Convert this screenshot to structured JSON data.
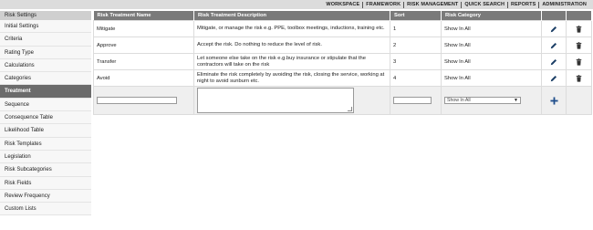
{
  "topnav": {
    "items": [
      "WORKSPACE",
      "FRAMEWORK",
      "RISK MANAGEMENT",
      "QUICK SEARCH",
      "REPORTS",
      "ADMINISTRATION"
    ]
  },
  "sidebar": {
    "header": "Risk Settings",
    "items": [
      {
        "label": "Initial Settings"
      },
      {
        "label": "Criteria"
      },
      {
        "label": "Rating Type"
      },
      {
        "label": "Calculations"
      },
      {
        "label": "Categories"
      },
      {
        "label": "Treatment",
        "active": true
      },
      {
        "label": "Sequence"
      },
      {
        "label": "Consequence Table"
      },
      {
        "label": "Likelihood Table"
      },
      {
        "label": "Risk Templates"
      },
      {
        "label": "Legislation"
      },
      {
        "label": "Risk Subcategories"
      },
      {
        "label": "Risk Fields"
      },
      {
        "label": "Review Frequency"
      },
      {
        "label": "Custom Lists"
      }
    ]
  },
  "table": {
    "columns": [
      "Risk Treatment Name",
      "Risk Treatment Description",
      "Sort",
      "Risk Category"
    ],
    "rows": [
      {
        "name": "Mitigate",
        "description": "Mitigate, or manage the risk e.g. PPE, toolbox meetings, inductions, training etc.",
        "sort": "1",
        "category": "Show In All"
      },
      {
        "name": "Approve",
        "description": "Accept the risk. Do nothing to reduce the level of risk.",
        "sort": "2",
        "category": "Show In All"
      },
      {
        "name": "Transfer",
        "description": "Let someone else take on the risk e.g.buy insurance or stipulate that the contractors will take on the risk",
        "sort": "3",
        "category": "Show In All"
      },
      {
        "name": "Avoid",
        "description": "Eliminate the risk completely by avoiding the risk, closing the service, working at night to avoid sunburn etc.",
        "sort": "4",
        "category": "Show In All"
      }
    ],
    "new_row": {
      "name": "",
      "description": "",
      "sort": "",
      "category_selected": "Show In All"
    }
  },
  "colors": {
    "topbar": "#dcdcdc",
    "header": "#7a7a7a",
    "active_side": "#6b6b6b",
    "add_icon": "#1f4e8c"
  },
  "icons": {
    "edit": "pencil-icon",
    "delete": "trash-icon",
    "add": "plus-icon",
    "dropdown": "chevron-down-icon"
  }
}
